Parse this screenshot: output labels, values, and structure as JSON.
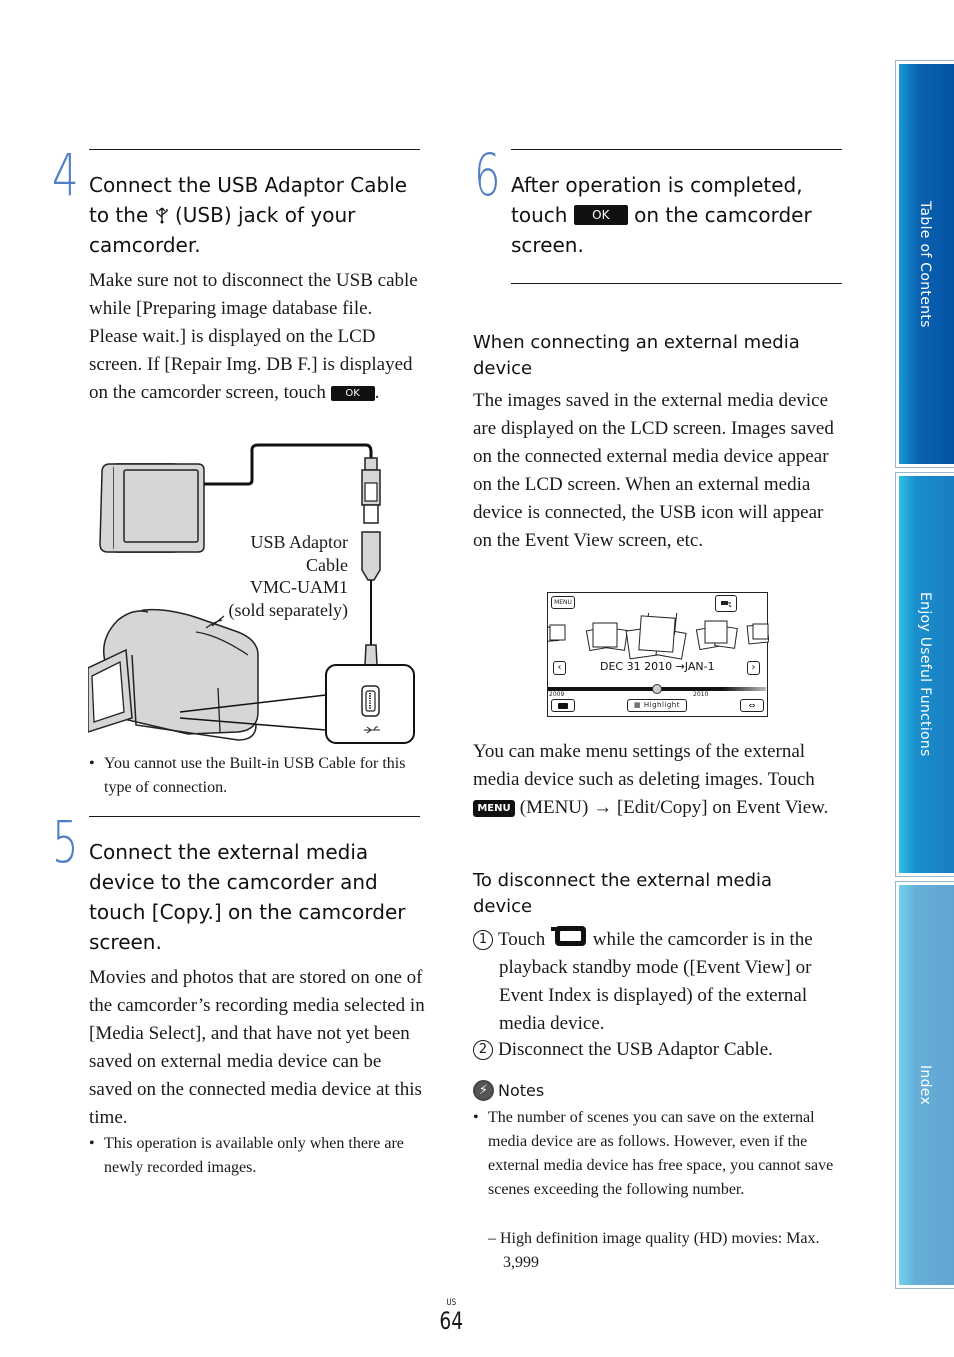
{
  "side_tabs": [
    {
      "label": "Table of Contents"
    },
    {
      "label": "Enjoy Useful Functions"
    },
    {
      "label": "Index"
    }
  ],
  "colors": {
    "step_number": "#4f7ec2",
    "tab_toc": "#0552a5",
    "tab_enjoy": "#1a7dc2",
    "tab_index": "#62a5d4"
  },
  "step4": {
    "number": "4",
    "title_part1": "Connect the USB Adaptor Cable to the ",
    "usb_icon": "usb-icon",
    "title_part2": " (USB) jack of your camcorder.",
    "body_before_ok": "Make sure not to disconnect the USB cable while [Preparing image database file. Please wait.] is displayed on the LCD screen. If [Repair Img. DB F.] is displayed on the camcorder screen, touch ",
    "ok_label": "OK",
    "body_after_ok": ".",
    "diagram": {
      "label_lines": [
        "USB Adaptor",
        "Cable",
        "VMC-UAM1",
        "(sold separately)"
      ]
    },
    "bullet": "You cannot use the Built-in USB Cable for this type of connection."
  },
  "step5": {
    "number": "5",
    "title": "Connect the external media device to the camcorder and touch [Copy.] on the camcorder screen.",
    "body": "Movies and photos that are stored on one of the camcorder’s recording media selected in [Media Select], and that have not yet been saved on external media device can be saved on the connected media device at this time.",
    "bullet": "This operation is available only when there are newly recorded images."
  },
  "step6": {
    "number": "6",
    "title_part1": "After operation is completed, touch ",
    "ok_label": "OK",
    "title_part2": " on the camcorder screen."
  },
  "external_media": {
    "heading": "When connecting an external media device",
    "body": "The images saved in the external media device are displayed on the LCD screen. Images saved on the connected external media device appear on the LCD screen. When an external media device is connected, the USB icon will appear on the Event View screen, etc.",
    "event_view": {
      "menu_label": "MENU",
      "date_range": "DEC 31 2010 →JAN-1",
      "year_left": "2009",
      "year_right": "2010",
      "highlight_label": "Highlight",
      "prev_label": "‹",
      "next_label": "›"
    },
    "menu_text_1": "You can make menu settings of the external media device such as deleting images. Touch ",
    "menu_label": "MENU",
    "menu_text_2": " (MENU) ",
    "arrow": "→",
    "menu_text_3": " [Edit/Copy] on Event View."
  },
  "disconnect": {
    "heading": "To disconnect the external media device",
    "step1_num": "1",
    "step1_before_icon": "Touch ",
    "step1_after_icon": " while the camcorder is in the playback standby mode ([Event View] or Event Index is displayed) of the external media device.",
    "step2_num": "2",
    "step2_text": "Disconnect the USB Adaptor Cable."
  },
  "notes": {
    "heading": "Notes",
    "bullet": "The number of scenes you can save on the external media device are as follows. However, even if the external media device has free space, you cannot save scenes exceeding the following number.",
    "sub_item": "– High definition image quality (HD) movies: Max. 3,999"
  },
  "footer": {
    "region": "US",
    "page_number": "64"
  }
}
